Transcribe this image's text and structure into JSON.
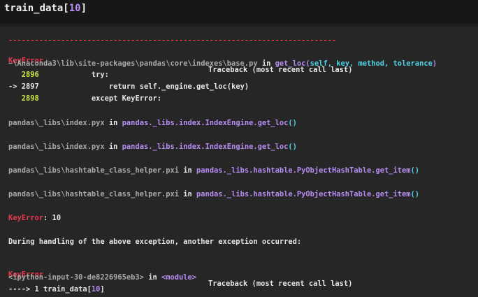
{
  "input": {
    "code_prefix": "train_data[",
    "code_index": "10",
    "code_suffix": "]"
  },
  "traceback1": {
    "divider": "---------------------------------------------------------------------------",
    "error_name": "KeyError",
    "header": "Traceback (most recent call last)",
    "frame1": {
      "path": "~\\Anaconda3\\lib\\site-packages\\pandas\\core\\indexes\\base.py",
      "in": " in ",
      "func": "get_loc",
      "args_open": "(",
      "args": "self, key, method, tolerance",
      "args_close": ")",
      "lines": [
        {
          "marker": "   ",
          "num": "2896",
          "code": "            try:"
        },
        {
          "marker": "-> ",
          "num": "2897",
          "code": "                return self._engine.get_loc(key)"
        },
        {
          "marker": "   ",
          "num": "2898",
          "code": "            except KeyError:"
        }
      ]
    },
    "frame2": {
      "path": "pandas\\_libs\\index.pyx",
      "in": " in ",
      "func": "pandas._libs.index.IndexEngine.get_loc",
      "parens": "()"
    },
    "frame3": {
      "path": "pandas\\_libs\\index.pyx",
      "in": " in ",
      "func": "pandas._libs.index.IndexEngine.get_loc",
      "parens": "()"
    },
    "frame4": {
      "path": "pandas\\_libs\\hashtable_class_helper.pxi",
      "in": " in ",
      "func": "pandas._libs.hashtable.PyObjectHashTable.get_item",
      "parens": "()"
    },
    "frame5": {
      "path": "pandas\\_libs\\hashtable_class_helper.pxi",
      "in": " in ",
      "func": "pandas._libs.hashtable.PyObjectHashTable.get_item",
      "parens": "()"
    },
    "final_error_name": "KeyError",
    "final_error_msg": ": 10"
  },
  "during": "During handling of the above exception, another exception occurred:",
  "traceback2": {
    "error_name": "KeyError",
    "header": "Traceback (most recent call last)",
    "frame": {
      "path": "<ipython-input-30-de8226965eb3>",
      "in": " in ",
      "func": "<module>"
    },
    "arrow_line": {
      "marker": "----> 1 ",
      "code_prefix": "train_data[",
      "code_index": "10",
      "code_suffix": "]"
    }
  },
  "colors": {
    "background": "#262626",
    "error_red": "#e8374f",
    "path_gray": "#a9a9a9",
    "func_purple": "#b78cf2",
    "args_cyan": "#4fd1e6",
    "lineno_green": "#c8e54a"
  }
}
